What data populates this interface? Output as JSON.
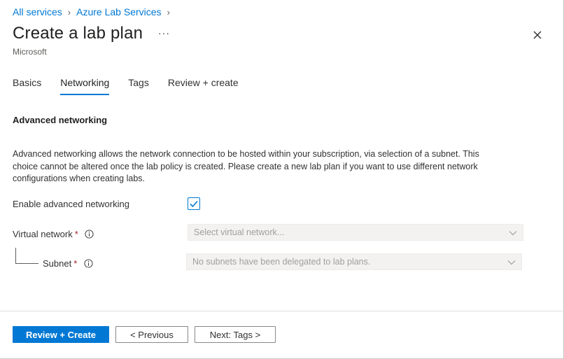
{
  "breadcrumb": {
    "items": [
      "All services",
      "Azure Lab Services"
    ]
  },
  "header": {
    "title": "Create a lab plan",
    "more_label": "···",
    "subtitle": "Microsoft"
  },
  "tabs": [
    {
      "label": "Basics",
      "active": false
    },
    {
      "label": "Networking",
      "active": true
    },
    {
      "label": "Tags",
      "active": false
    },
    {
      "label": "Review + create",
      "active": false
    }
  ],
  "section": {
    "title": "Advanced networking",
    "description_lines": [
      "Advanced networking allows the network connection to be hosted within your subscription, via selection of a subnet. This",
      "choice cannot be altered once the lab policy is created. Please create a new lab plan if you want to use different network",
      "configurations when creating labs."
    ]
  },
  "form": {
    "enable_label": "Enable advanced networking",
    "enable_checked": true,
    "vnet_label": "Virtual network",
    "vnet_required": "*",
    "vnet_placeholder": "Select virtual network...",
    "subnet_label": "Subnet",
    "subnet_required": "*",
    "subnet_placeholder": "No subnets have been delegated to lab plans."
  },
  "footer": {
    "primary_label": "Review + Create",
    "previous_label": "< Previous",
    "next_label": "Next: Tags >"
  },
  "colors": {
    "accent": "#0078d4",
    "required": "#a4262c",
    "disabled_bg": "#f3f2f1"
  }
}
